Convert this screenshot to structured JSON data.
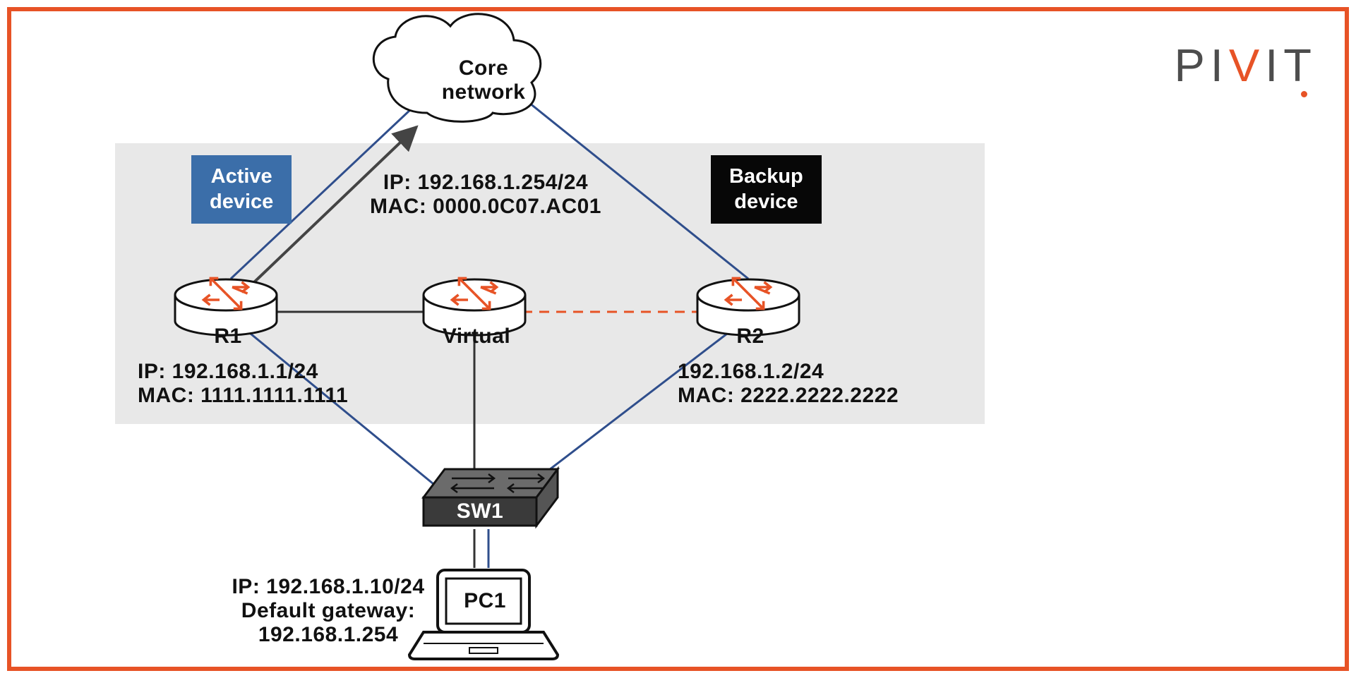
{
  "logo": "PIVIT",
  "cloud": {
    "line1": "Core",
    "line2": "network"
  },
  "tags": {
    "active_line1": "Active",
    "active_line2": "device",
    "backup_line1": "Backup",
    "backup_line2": "device"
  },
  "virtual": {
    "ip": "IP: 192.168.1.254/24",
    "mac": "MAC: 0000.0C07.AC01",
    "name": "Virtual"
  },
  "r1": {
    "name": "R1",
    "ip": "IP: 192.168.1.1/24",
    "mac": "MAC: 1111.1111.1111"
  },
  "r2": {
    "name": "R2",
    "ip": "192.168.1.2/24",
    "mac": "MAC: 2222.2222.2222"
  },
  "switch": {
    "name": "SW1"
  },
  "pc": {
    "name": "PC1",
    "ip": "IP: 192.168.1.10/24",
    "gw1": "Default gateway:",
    "gw2": "192.168.1.254"
  }
}
